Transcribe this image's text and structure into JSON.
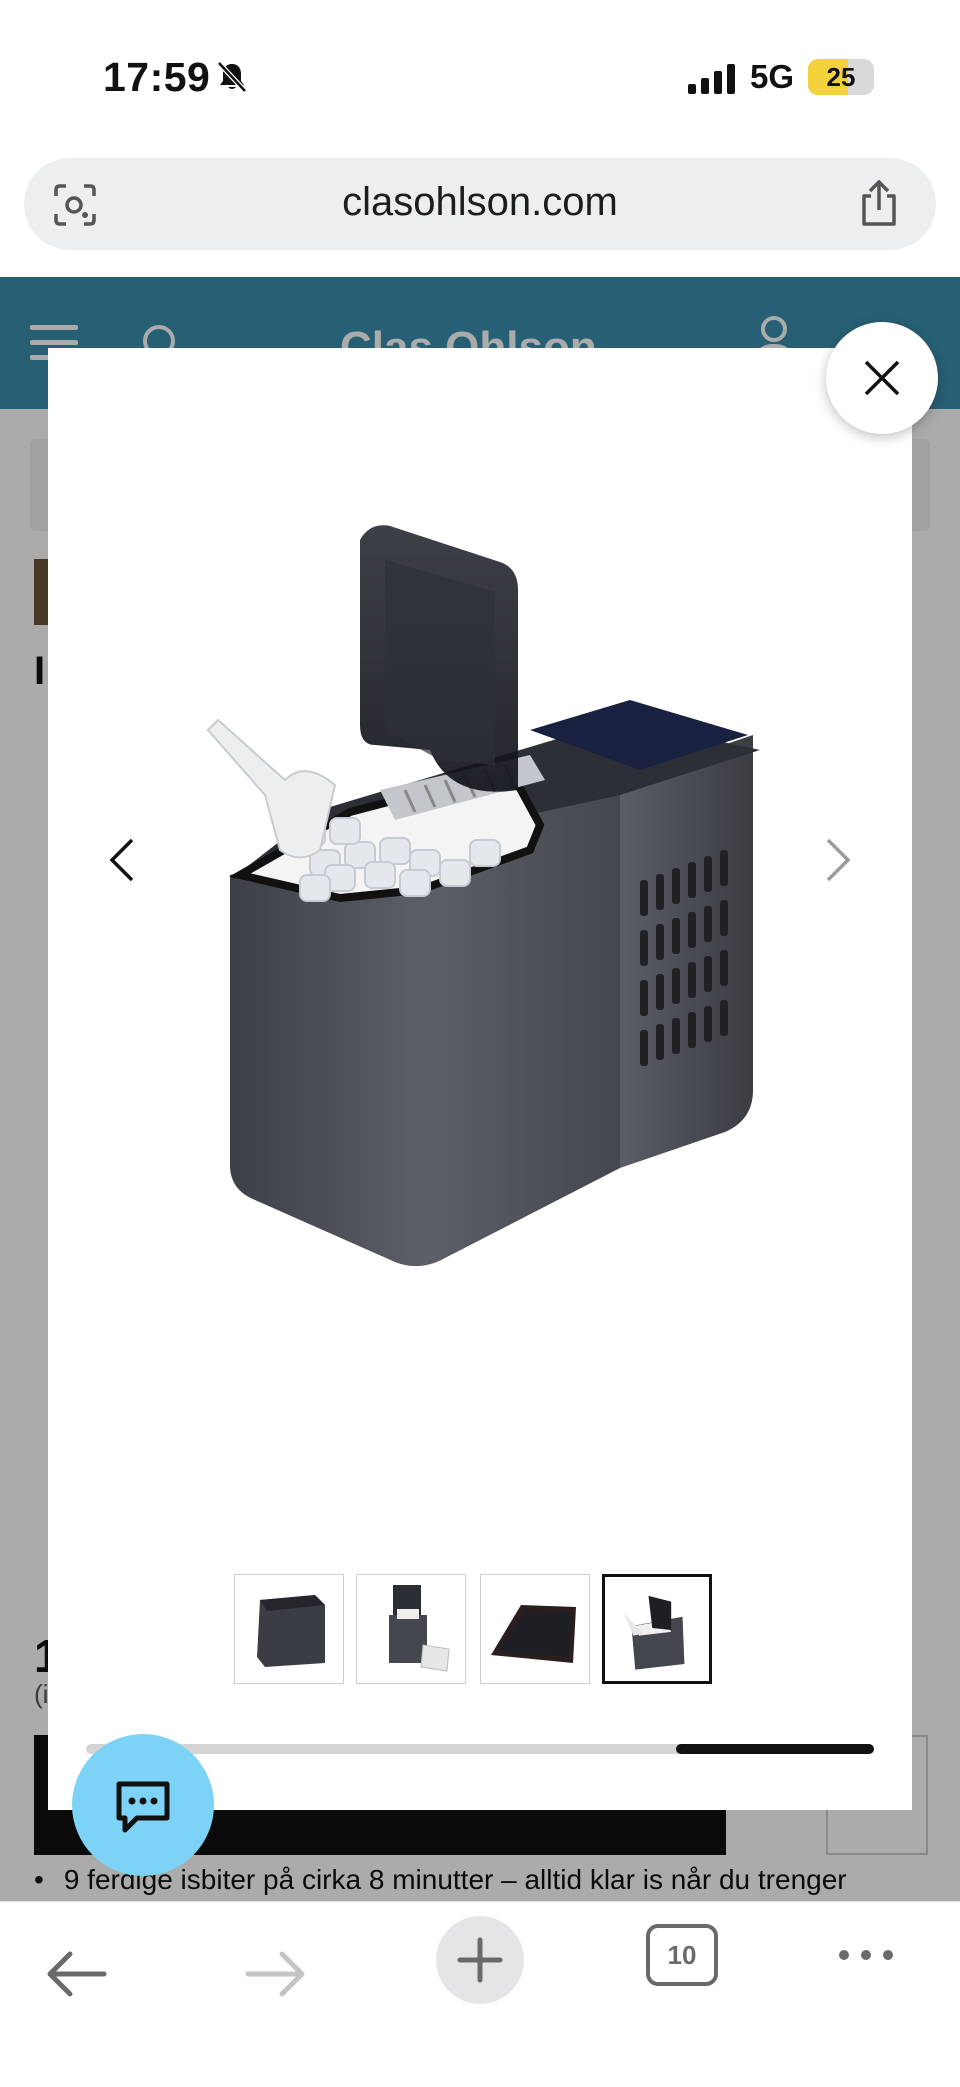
{
  "status_bar": {
    "time": "17:59",
    "network": "5G",
    "battery": "25"
  },
  "browser": {
    "url": "clasohlson.com",
    "tab_count": "10"
  },
  "site": {
    "logo_text": "Clas Ohlson"
  },
  "page_behind": {
    "title_fragment": "I",
    "price_fragment": "1",
    "price_note_fragment": "(i",
    "bullet_text": "9 ferdige isbiter på cirka 8 minutter – alltid klar is når du trenger"
  },
  "gallery": {
    "thumbnails": [
      {
        "name": "ice-maker-closed-front",
        "active": false
      },
      {
        "name": "ice-maker-open-with-ice",
        "active": false
      },
      {
        "name": "ice-maker-top-panel",
        "active": false
      },
      {
        "name": "ice-maker-open-scoop",
        "active": true
      }
    ],
    "scroll_position": 1.0
  },
  "colors": {
    "header": "#3b8fad",
    "chat_button": "#7dd3f5",
    "battery": "#f3d23a"
  },
  "icons": [
    "bell-slash-icon",
    "signal-icon",
    "camera-search-icon",
    "share-icon",
    "menu-icon",
    "search-icon",
    "user-icon",
    "close-icon",
    "chevron-left-icon",
    "chevron-right-icon",
    "chat-icon",
    "back-icon",
    "forward-icon",
    "plus-icon",
    "tabs-icon",
    "more-icon"
  ]
}
